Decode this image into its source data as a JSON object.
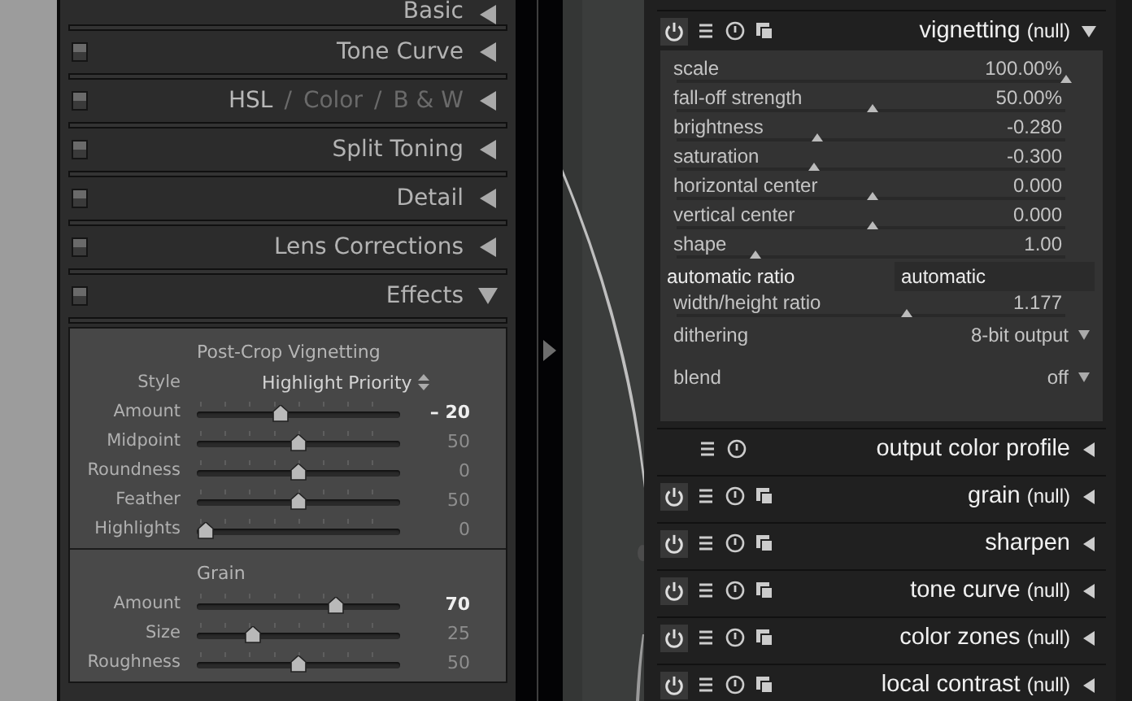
{
  "lightroom": {
    "sections": [
      {
        "title": "Basic",
        "expanded": false
      },
      {
        "title": "Tone Curve",
        "enabled": true,
        "expanded": false
      },
      {
        "enabled": true,
        "parts": [
          {
            "label": "HSL",
            "selected": true
          },
          {
            "label": "/",
            "selected": false
          },
          {
            "label": "Color",
            "selected": false
          },
          {
            "label": "/",
            "selected": false
          },
          {
            "label": "B & W",
            "selected": false
          }
        ],
        "expanded": false
      },
      {
        "title": "Split Toning",
        "enabled": true,
        "expanded": false
      },
      {
        "title": "Detail",
        "enabled": true,
        "expanded": false
      },
      {
        "title": "Lens Corrections",
        "enabled": true,
        "expanded": false
      },
      {
        "title": "Effects",
        "enabled": true,
        "expanded": true
      }
    ],
    "effects": [
      {
        "title": "Post-Crop Vignetting",
        "style": {
          "label": "Style",
          "value": "Highlight Priority"
        },
        "sliders": [
          {
            "label": "Amount",
            "value": "– 20",
            "level": 0.4,
            "modified": true
          },
          {
            "label": "Midpoint",
            "value": "50",
            "level": 0.5,
            "modified": false
          },
          {
            "label": "Roundness",
            "value": "0",
            "level": 0.5,
            "modified": false
          },
          {
            "label": "Feather",
            "value": "50",
            "level": 0.5,
            "modified": false
          },
          {
            "label": "Highlights",
            "value": "0",
            "level": 0,
            "modified": false
          }
        ]
      },
      {
        "title": "Grain",
        "sliders": [
          {
            "label": "Amount",
            "value": "70",
            "level": 0.7,
            "modified": true
          },
          {
            "label": "Size",
            "value": "25",
            "level": 0.25,
            "modified": false
          },
          {
            "label": "Roughness",
            "value": "50",
            "level": 0.5,
            "modified": false
          }
        ]
      }
    ]
  },
  "darktable": {
    "modules": [
      {
        "name": "vignetting",
        "suffix": "(null)",
        "kind": "full",
        "enabled": true,
        "expanded": true,
        "params": [
          {
            "kind": "slider",
            "label": "scale",
            "value": "100.00%",
            "level": 1
          },
          {
            "kind": "slider",
            "label": "fall-off strength",
            "value": "50.00%",
            "level": 0.5
          },
          {
            "kind": "slider",
            "label": "brightness",
            "value": "-0.280",
            "level": 0.36
          },
          {
            "kind": "slider",
            "label": "saturation",
            "value": "-0.300",
            "level": 0.35
          },
          {
            "kind": "slider",
            "label": "horizontal center",
            "value": "0.000",
            "level": 0.5
          },
          {
            "kind": "slider",
            "label": "vertical center",
            "value": "0.000",
            "level": 0.5
          },
          {
            "kind": "slider",
            "label": "shape",
            "value": "1.00",
            "level": 0.2
          },
          {
            "kind": "toggle",
            "label": "automatic ratio",
            "value": "automatic"
          },
          {
            "kind": "slider",
            "label": "width/height ratio",
            "value": "1.177",
            "level": 0.59
          },
          {
            "kind": "combo",
            "label": "dithering",
            "value": "8-bit output"
          },
          {
            "kind": "combo",
            "label": "blend",
            "value": "off"
          }
        ]
      },
      {
        "name": "output color profile",
        "kind": "basic",
        "expanded": false
      },
      {
        "name": "grain",
        "suffix": "(null)",
        "kind": "full",
        "enabled": true,
        "expanded": false
      },
      {
        "name": "sharpen",
        "kind": "full",
        "enabled": true,
        "expanded": false
      },
      {
        "name": "tone curve",
        "suffix": "(null)",
        "kind": "full",
        "enabled": true,
        "expanded": false
      },
      {
        "name": "color zones",
        "suffix": "(null)",
        "kind": "full",
        "enabled": true,
        "expanded": false
      },
      {
        "name": "local contrast",
        "suffix": "(null)",
        "kind": "full",
        "enabled": true,
        "expanded": false
      }
    ]
  }
}
